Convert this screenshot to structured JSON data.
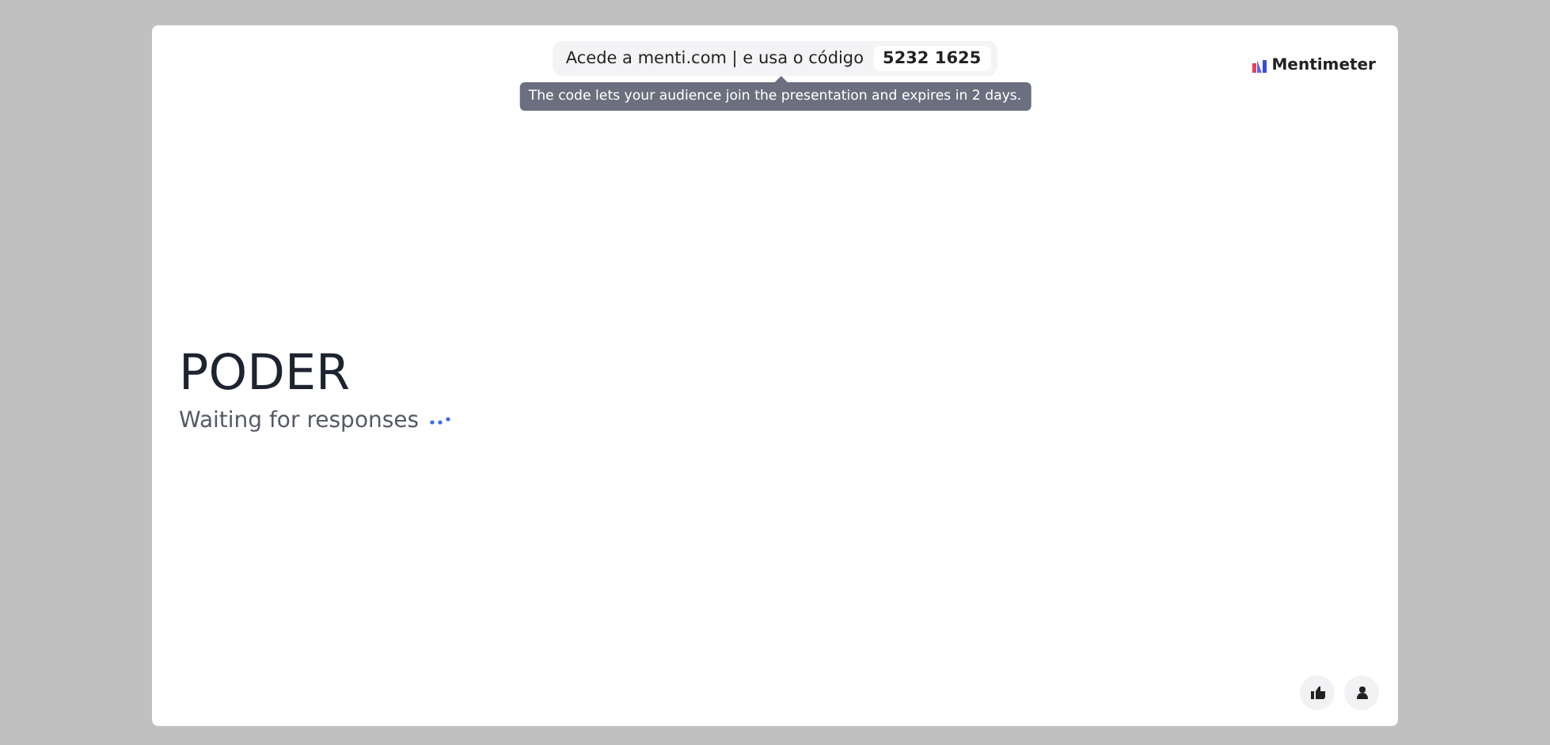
{
  "join_bar": {
    "instruction": "Acede a menti.com | e usa o código",
    "code": "5232 1625"
  },
  "tooltip": {
    "text": "The code lets your audience join the presentation and expires in 2 days."
  },
  "brand": {
    "name": "Mentimeter"
  },
  "slide": {
    "title": "PODER",
    "status": "Waiting for responses"
  },
  "buttons": [
    {
      "kind": "reaction"
    },
    {
      "kind": "audience"
    }
  ]
}
